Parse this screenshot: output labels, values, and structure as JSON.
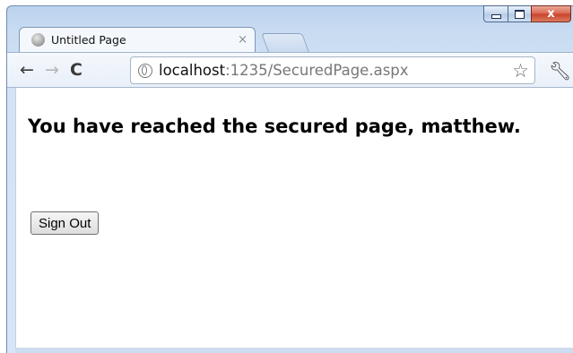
{
  "browser": {
    "tab_title": "Untitled Page",
    "tab_close": "×",
    "window_close": "x",
    "url_host": "localhost",
    "url_path": ":1235/SecuredPage.aspx",
    "icons": {
      "back": "back-arrow-icon",
      "forward": "forward-arrow-icon",
      "reload": "reload-icon",
      "bookmark": "star-icon",
      "settings": "wrench-icon",
      "page": "globe-icon"
    }
  },
  "page": {
    "heading": "You have reached the secured page, matthew.",
    "signout_label": "Sign Out"
  }
}
